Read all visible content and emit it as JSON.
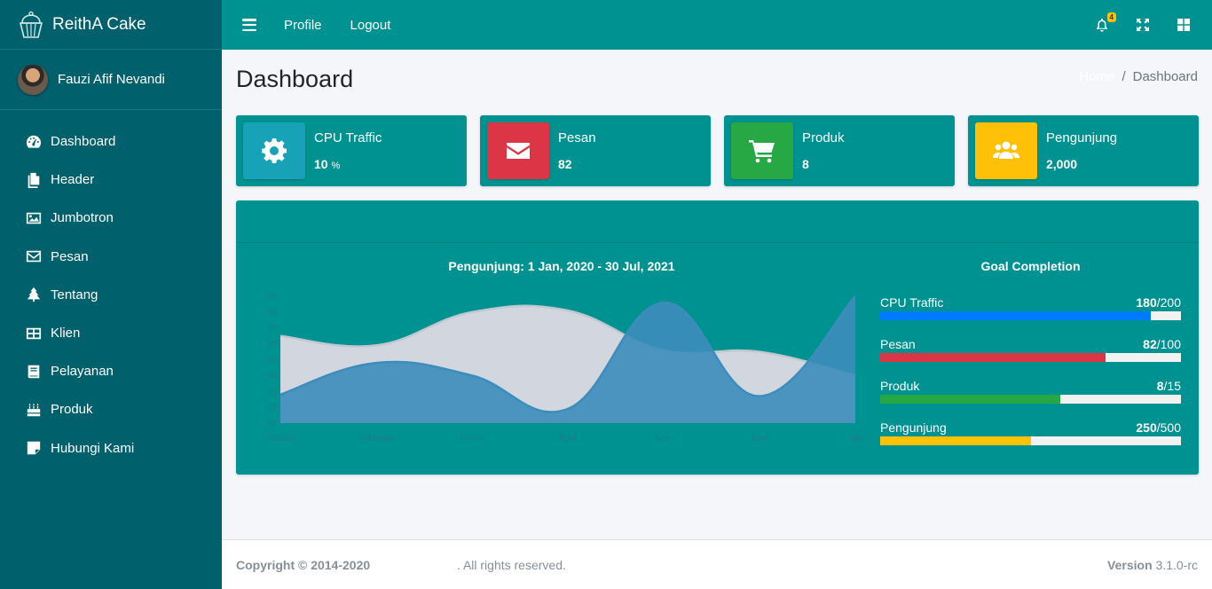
{
  "brand": {
    "name": "ReithA Cake"
  },
  "user": {
    "name": "Fauzi Afif Nevandi"
  },
  "sidebar": {
    "items": [
      {
        "label": "Dashboard",
        "icon": "tachometer-icon"
      },
      {
        "label": "Header",
        "icon": "copy-icon"
      },
      {
        "label": "Jumbotron",
        "icon": "image-icon"
      },
      {
        "label": "Pesan",
        "icon": "envelope-icon"
      },
      {
        "label": "Tentang",
        "icon": "tree-icon"
      },
      {
        "label": "Klien",
        "icon": "th-large-icon"
      },
      {
        "label": "Pelayanan",
        "icon": "book-icon"
      },
      {
        "label": "Produk",
        "icon": "birthday-cake-icon"
      },
      {
        "label": "Hubungi Kami",
        "icon": "sticky-note-icon"
      }
    ]
  },
  "topbar": {
    "links": [
      "Profile",
      "Logout"
    ],
    "notifications_count": "4"
  },
  "page": {
    "title": "Dashboard",
    "breadcrumb": [
      "Home",
      "Dashboard"
    ]
  },
  "info_boxes": [
    {
      "label": "CPU Traffic",
      "value": "10",
      "unit": "%",
      "color": "#17a2b8",
      "icon": "gear-icon"
    },
    {
      "label": "Pesan",
      "value": "82",
      "unit": "",
      "color": "#dc3545",
      "icon": "envelope-icon"
    },
    {
      "label": "Produk",
      "value": "8",
      "unit": "",
      "color": "#28a745",
      "icon": "shopping-cart-icon"
    },
    {
      "label": "Pengunjung",
      "value": "2,000",
      "unit": "",
      "color": "#ffc107",
      "icon": "users-icon"
    }
  ],
  "chart_data": {
    "type": "area",
    "title": "Pengunjung: 1 Jan, 2020 - 30 Jul, 2021",
    "categories": [
      "January",
      "February",
      "March",
      "April",
      "May",
      "June",
      "July"
    ],
    "ylim": [
      10,
      90
    ],
    "yticks": [
      10,
      20,
      30,
      40,
      50,
      60,
      70,
      80,
      90
    ],
    "series": [
      {
        "values": [
          28,
          48,
          40,
          19,
          86,
          27,
          90
        ],
        "color": "#3c8dbc"
      },
      {
        "values": [
          65,
          59,
          80,
          81,
          56,
          55,
          40
        ],
        "color": "#d2d6de"
      }
    ],
    "grid": false
  },
  "goals": {
    "title": "Goal Completion",
    "items": [
      {
        "label": "CPU Traffic",
        "value": "180",
        "total": "/200",
        "fraction": 0.9,
        "color": "#007bff"
      },
      {
        "label": "Pesan",
        "value": "82",
        "total": "/100",
        "fraction": 0.75,
        "color": "#dc3545"
      },
      {
        "label": "Produk",
        "value": "8",
        "total": "/15",
        "fraction": 0.6,
        "color": "#28a745"
      },
      {
        "label": "Pengunjung",
        "value": "250",
        "total": "/500",
        "fraction": 0.5,
        "color": "#ffc107"
      }
    ]
  },
  "footer": {
    "copyright": "Copyright © 2014-2020",
    "rights": ". All rights reserved.",
    "version_label": "Version",
    "version": "3.1.0-rc"
  }
}
